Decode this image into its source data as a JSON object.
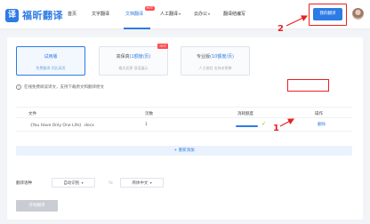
{
  "brand": {
    "logo_glyph": "译",
    "name": "福昕翻译",
    "accent": "#2d7be5"
  },
  "nav": {
    "items": [
      {
        "label": "首页"
      },
      {
        "label": "文字翻译"
      },
      {
        "label": "文档翻译",
        "active": true,
        "badge": "HOT"
      },
      {
        "label": "人工翻译",
        "dropdown": true
      },
      {
        "label": "云办公",
        "dropdown": true
      },
      {
        "label": "翻译结编写"
      }
    ],
    "my_translation_button": "我的翻译"
  },
  "annotations": {
    "marker_1": "1",
    "marker_2": "2",
    "color": "#e8201f"
  },
  "plans": [
    {
      "title": "试用版",
      "subtitle": "",
      "desc": "免费翻译 同比高资",
      "active": true
    },
    {
      "title": "高保真",
      "subtitle": "(1额度/页)",
      "desc": "格式还原 双语展示",
      "badge": "HOT"
    },
    {
      "title": "专业版",
      "subtitle": "(10额度/页)",
      "desc": "人工校验 支持对照审"
    }
  ],
  "notice": {
    "icon": "info-icon",
    "text": "在线免费阅读译文，支持下载原文和翻译原文"
  },
  "table": {
    "headers": [
      "文件",
      "页数",
      "消耗额度",
      "操作"
    ],
    "rows": [
      {
        "file": "《You Have Only One Life》.docx",
        "pages": "1",
        "progress": 1.0,
        "status_icon": "check-circle-icon",
        "action": "删除"
      }
    ]
  },
  "add_more": "+ 重新添加",
  "language": {
    "label": "翻译语种",
    "source": "自动识别",
    "target": "简体中文",
    "swap_icon": "swap-arrows-icon"
  },
  "start_button": "开始翻译"
}
